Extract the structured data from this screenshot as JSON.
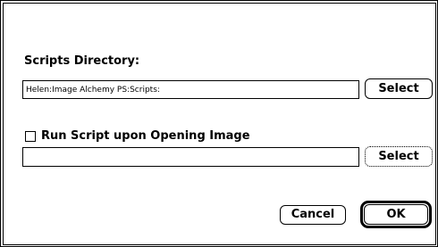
{
  "scripts_directory": {
    "label": "Scripts Directory:",
    "path_value": "Helen:Image Alchemy PS:Scripts:",
    "select_label": "Select"
  },
  "run_script": {
    "checkbox_label": "Run Script upon Opening Image",
    "checked": false,
    "path_value": "",
    "select_label": "Select"
  },
  "buttons": {
    "cancel_label": "Cancel",
    "ok_label": "OK"
  }
}
